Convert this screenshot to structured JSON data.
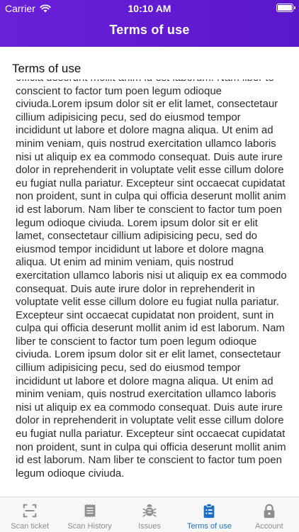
{
  "status_bar": {
    "carrier": "Carrier",
    "time": "10:10 AM"
  },
  "nav": {
    "title": "Terms of use"
  },
  "page": {
    "heading": "Terms of use",
    "body": "officia deserunt mollit anim id est laborum. Nam liber te conscient to factor tum poen legum odioque civiuda.Lorem ipsum dolor sit er elit lamet, consectetaur cillium adipisicing pecu, sed do eiusmod tempor incididunt ut labore et dolore magna aliqua. Ut enim ad minim veniam, quis nostrud exercitation ullamco laboris nisi ut aliquip ex ea commodo consequat. Duis aute irure dolor in reprehenderit in voluptate velit esse cillum dolore eu fugiat nulla pariatur. Excepteur sint occaecat cupidatat non proident, sunt in culpa qui officia deserunt mollit anim id est laborum. Nam liber te conscient to factor tum poen legum odioque civiuda. Lorem ipsum dolor sit er elit lamet, consectetaur cillium adipisicing pecu, sed do eiusmod tempor incididunt ut labore et dolore magna aliqua. Ut enim ad minim veniam, quis nostrud exercitation ullamco laboris nisi ut aliquip ex ea commodo consequat. Duis aute irure dolor in reprehenderit in voluptate velit esse cillum dolore eu fugiat nulla pariatur. Excepteur sint occaecat cupidatat non proident, sunt in culpa qui officia deserunt mollit anim id est laborum. Nam liber te conscient to factor tum poen legum odioque civiuda. Lorem ipsum dolor sit er elit lamet, consectetaur cillium adipisicing pecu, sed do eiusmod tempor incididunt ut labore et dolore magna aliqua. Ut enim ad minim veniam, quis nostrud exercitation ullamco laboris nisi ut aliquip ex ea commodo consequat. Duis aute irure dolor in reprehenderit in voluptate velit esse cillum dolore eu fugiat nulla pariatur. Excepteur sint occaecat cupidatat non proident, sunt in culpa qui officia deserunt mollit anim id est laborum. Nam liber te conscient to factor tum poen legum odioque civiuda."
  },
  "tabs": [
    {
      "label": "Scan ticket",
      "icon": "scan-icon",
      "active": false
    },
    {
      "label": "Scan History",
      "icon": "receipt-icon",
      "active": false
    },
    {
      "label": "Issues",
      "icon": "bug-icon",
      "active": false
    },
    {
      "label": "Terms of use",
      "icon": "clipboard-icon",
      "active": true
    },
    {
      "label": "Account",
      "icon": "lock-icon",
      "active": false
    }
  ],
  "colors": {
    "header": "#6a1fd8",
    "tab_active": "#1e6ec8",
    "tab_inactive": "#8e8e8e"
  }
}
